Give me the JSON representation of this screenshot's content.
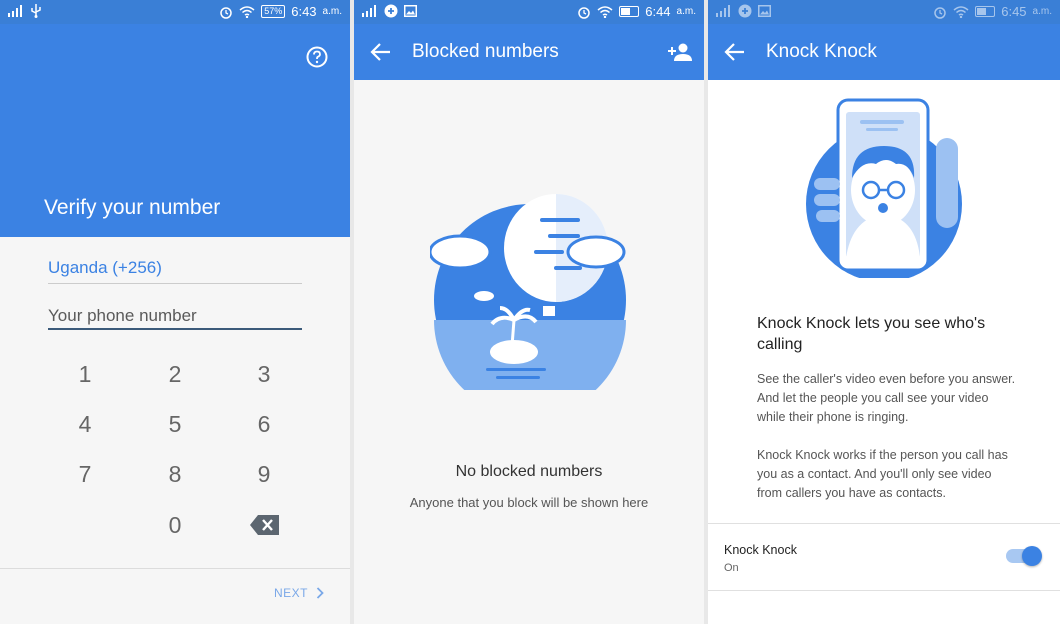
{
  "colors": {
    "primary": "#3b82e3",
    "primary_light": "#a8c8f2"
  },
  "panel1": {
    "status": {
      "battery": "57%",
      "time": "6:43",
      "ampm": "a.m."
    },
    "hero_title": "Verify your number",
    "country": "Uganda (+256)",
    "phone_placeholder": "Your phone number",
    "keys": [
      "1",
      "2",
      "3",
      "4",
      "5",
      "6",
      "7",
      "8",
      "9",
      "0"
    ],
    "next_label": "NEXT"
  },
  "panel2": {
    "status": {
      "time": "6:44",
      "ampm": "a.m."
    },
    "title": "Blocked numbers",
    "empty_title": "No blocked numbers",
    "empty_sub": "Anyone that you block will be shown here"
  },
  "panel3": {
    "status": {
      "time": "6:45",
      "ampm": "a.m."
    },
    "title": "Knock Knock",
    "heading": "Knock Knock lets you see who's calling",
    "para1": "See the caller's video even before you answer. And let the people you call see your video while their phone is ringing.",
    "para2": "Knock Knock works if the person you call has you as a contact. And you'll only see video from callers you have as contacts.",
    "setting_label": "Knock Knock",
    "setting_value": "On"
  }
}
